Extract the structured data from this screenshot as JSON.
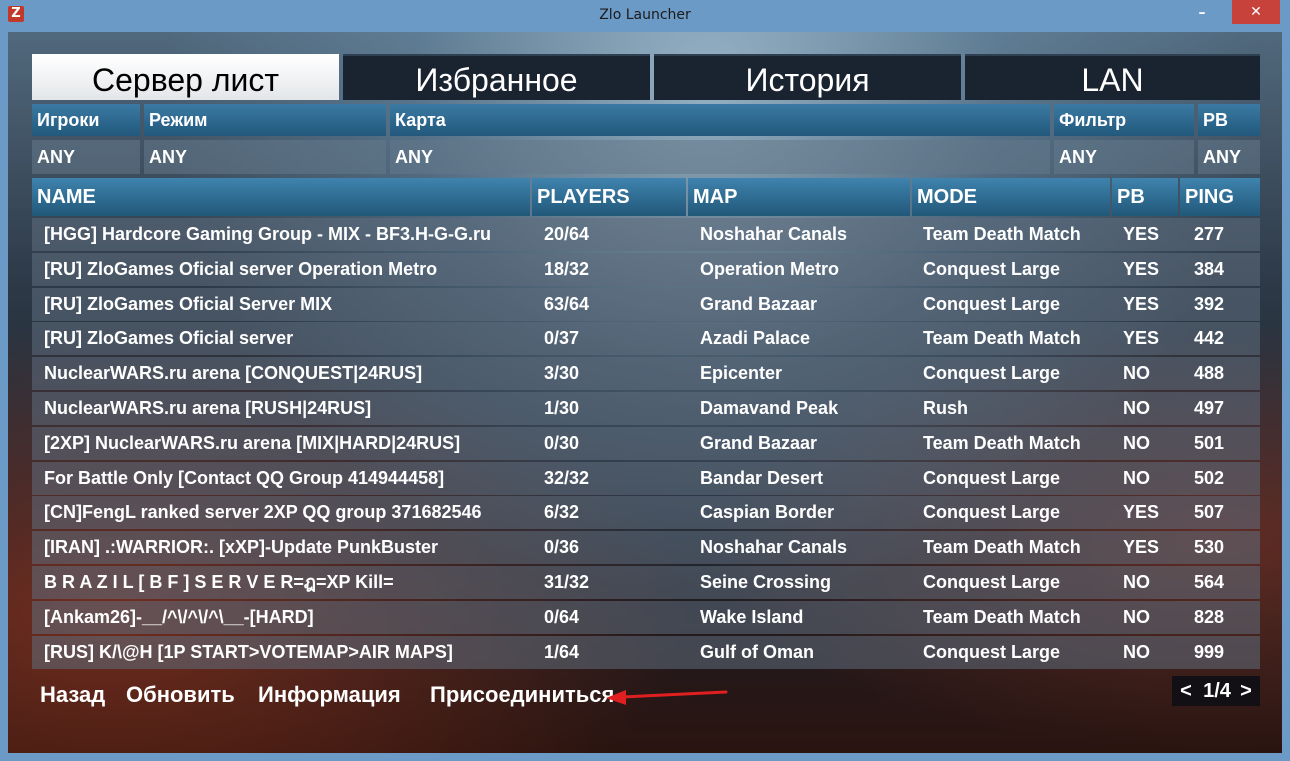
{
  "window": {
    "title": "Zlo Launcher",
    "logo": "Z",
    "minimize": "–",
    "close": "✕"
  },
  "tabs": [
    {
      "label": "Сервер лист",
      "active": true
    },
    {
      "label": "Избранное",
      "active": false
    },
    {
      "label": "История",
      "active": false
    },
    {
      "label": "LAN",
      "active": false
    }
  ],
  "filters": {
    "players": {
      "label": "Игроки",
      "value": "ANY"
    },
    "mode": {
      "label": "Режим",
      "value": "ANY"
    },
    "map": {
      "label": "Карта",
      "value": "ANY"
    },
    "filter": {
      "label": "Фильтр",
      "value": "ANY"
    },
    "pb": {
      "label": "PB",
      "value": "ANY"
    }
  },
  "table": {
    "headers": {
      "name": "NAME",
      "players": "PLAYERS",
      "map": "MAP",
      "mode": "MODE",
      "pb": "PB",
      "ping": "PING"
    },
    "rows": [
      {
        "name": "[HGG] Hardcore Gaming Group - MIX - BF3.H-G-G.ru",
        "players": "20/64",
        "map": "Noshahar Canals",
        "mode": "Team Death Match",
        "pb": "YES",
        "ping": "277"
      },
      {
        "name": "[RU] ZloGames Oficial server Operation Metro",
        "players": "18/32",
        "map": "Operation Metro",
        "mode": "Conquest Large",
        "pb": "YES",
        "ping": "384"
      },
      {
        "name": "[RU] ZloGames Oficial Server MIX",
        "players": "63/64",
        "map": "Grand Bazaar",
        "mode": "Conquest Large",
        "pb": "YES",
        "ping": "392"
      },
      {
        "name": "[RU] ZloGames Oficial server",
        "players": "0/37",
        "map": "Azadi Palace",
        "mode": "Team Death Match",
        "pb": "YES",
        "ping": "442"
      },
      {
        "name": "NuclearWARS.ru arena [CONQUEST|24RUS]",
        "players": "3/30",
        "map": "Epicenter",
        "mode": "Conquest Large",
        "pb": "NO",
        "ping": "488"
      },
      {
        "name": "NuclearWARS.ru arena [RUSH|24RUS]",
        "players": "1/30",
        "map": "Damavand Peak",
        "mode": "Rush",
        "pb": "NO",
        "ping": "497"
      },
      {
        "name": "[2XP] NuclearWARS.ru arena [MIX|HARD|24RUS]",
        "players": "0/30",
        "map": "Grand Bazaar",
        "mode": "Team Death Match",
        "pb": "NO",
        "ping": "501"
      },
      {
        "name": "For Battle Only [Contact QQ Group 414944458]",
        "players": "32/32",
        "map": "Bandar Desert",
        "mode": "Conquest Large",
        "pb": "NO",
        "ping": "502"
      },
      {
        "name": "[CN]FengL ranked server 2XP QQ group 371682546",
        "players": "6/32",
        "map": "Caspian Border",
        "mode": "Conquest Large",
        "pb": "YES",
        "ping": "507"
      },
      {
        "name": "[IRAN] .:WARRIOR:. [xXP]-Update PunkBuster",
        "players": "0/36",
        "map": "Noshahar Canals",
        "mode": "Team Death Match",
        "pb": "YES",
        "ping": "530"
      },
      {
        "name": "B R A Z I L [ B F ] S E R V E R=ฎ=XP Kill=",
        "players": "31/32",
        "map": "Seine Crossing",
        "mode": "Conquest Large",
        "pb": "NO",
        "ping": "564"
      },
      {
        "name": "[Ankam26]-__/^\\/^\\/^\\__-[HARD]",
        "players": "0/64",
        "map": "Wake Island",
        "mode": "Team Death Match",
        "pb": "NO",
        "ping": "828"
      },
      {
        "name": "[RUS] K/\\@H [1P START>VOTEMAP>AIR MAPS]",
        "players": "1/64",
        "map": "Gulf of Oman",
        "mode": "Conquest Large",
        "pb": "NO",
        "ping": "999"
      }
    ]
  },
  "actions": {
    "back": "Назад",
    "refresh": "Обновить",
    "info": "Информация",
    "join": "Присоединиться"
  },
  "pager": {
    "prev": "<",
    "page": "1/4",
    "next": ">"
  },
  "colors": {
    "annotation_arrow": "#e02020",
    "close_button": "#c7423a",
    "window_frame": "#6c9ac6"
  }
}
